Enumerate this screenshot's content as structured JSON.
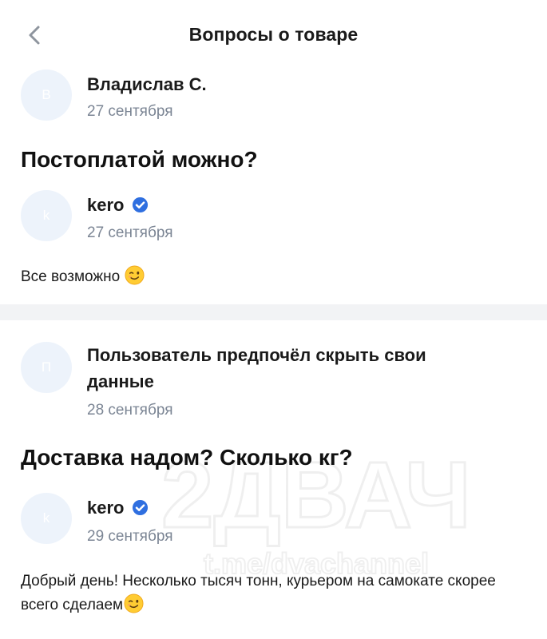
{
  "header": {
    "title": "Вопросы о товаре",
    "back_icon": "chevron-left-icon"
  },
  "questions": [
    {
      "author": {
        "initial": "В",
        "name": "Владислав С.",
        "date": "27 сентября"
      },
      "question": "Постоплатой можно?",
      "answer": {
        "author": {
          "initial": "k",
          "name": "kero",
          "date": "27 сентября",
          "verified": true
        },
        "text": "Все возможно",
        "emoji": "winking-face-emoji"
      }
    },
    {
      "author": {
        "initial": "П",
        "name": "Пользователь предпочёл скрыть свои данные",
        "date": "28 сентября"
      },
      "question": "Доставка надом? Сколько кг?",
      "answer": {
        "author": {
          "initial": "k",
          "name": "kero",
          "date": "29 сентября",
          "verified": true
        },
        "text": "Добрый день! Несколько тысяч тонн, курьером на самокате скорее всего сделаем",
        "emoji": "winking-face-emoji"
      }
    }
  ],
  "watermark": {
    "line1": "2ДВАЧ",
    "line2": "t.me/dvachannel"
  },
  "colors": {
    "verified": "#2f6fe0",
    "date": "#7b8594",
    "avatar_bg": "#edf3fb",
    "divider": "#f2f3f5"
  }
}
